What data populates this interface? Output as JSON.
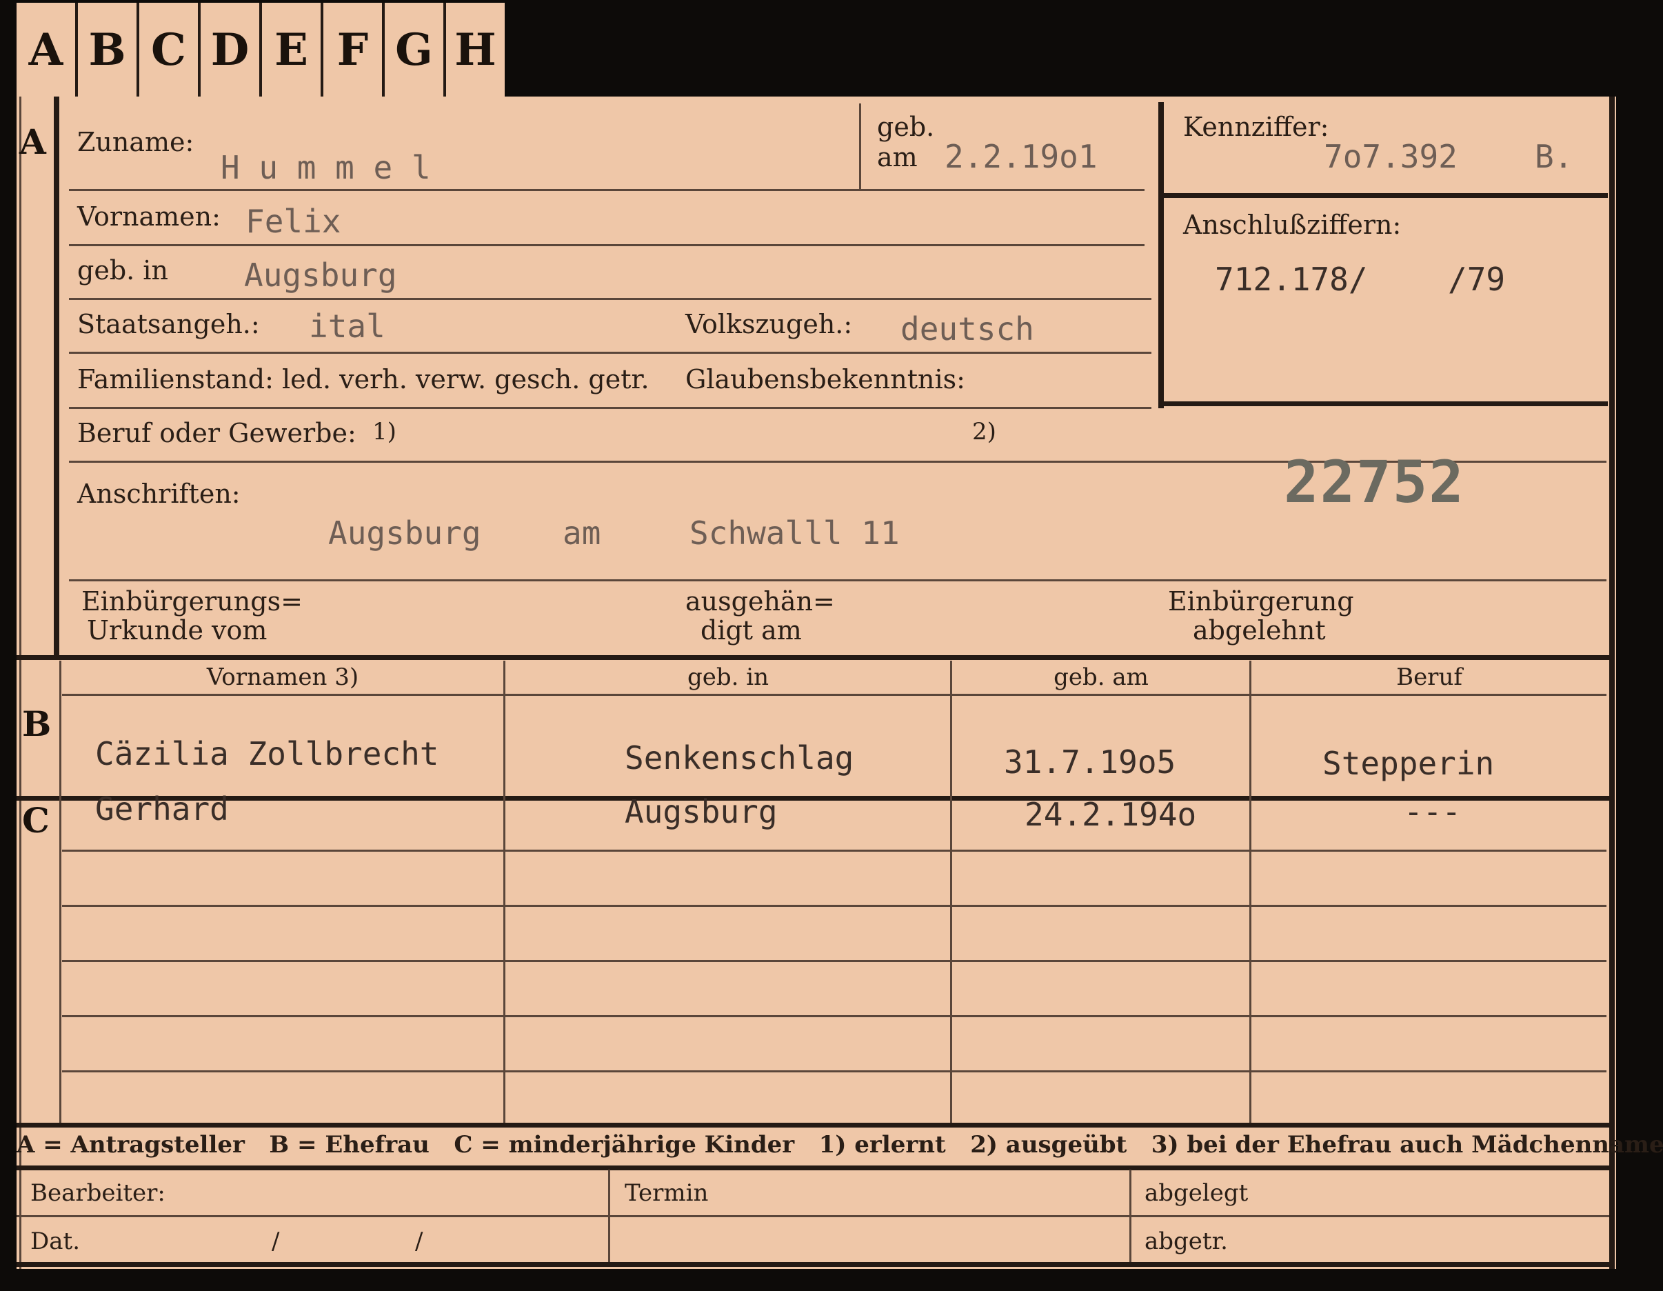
{
  "tabs": [
    "A",
    "B",
    "C",
    "D",
    "E",
    "F",
    "G",
    "H"
  ],
  "sections": {
    "a": "A",
    "b": "B",
    "c": "C"
  },
  "applicant": {
    "surname_label": "Zuname:",
    "surname": "H u m m e l",
    "birth_label_1": "geb.",
    "birth_label_2": "am",
    "birth_date": "2.2.19o1",
    "firstnames_label": "Vornamen:",
    "firstnames": "Felix",
    "birthplace_label": "geb. in",
    "birthplace": "Augsburg",
    "citizenship_label": "Staatsangeh.:",
    "citizenship": "ital",
    "ethnicity_label": "Volkszugeh.:",
    "ethnicity": "deutsch",
    "family_status_label": "Familienstand: led. verh. verw. gesch. getr.",
    "religion_label": "Glaubensbekenntnis:",
    "profession_label": "Beruf oder Gewerbe:",
    "profession_fn1": "1)",
    "profession_fn2": "2)",
    "addresses_label": "Anschriften:",
    "address_city": "Augsburg",
    "address_am": "am",
    "address_street": "Schwalll 11"
  },
  "reference": {
    "id_label": "Kennziffer:",
    "id_value": "7o7.392",
    "id_suffix": "B.",
    "links_label": "Anschlußziffern:",
    "links_value": "712.178/",
    "links_value_2": "/79"
  },
  "stamp_number": "22752",
  "naturalization": {
    "certificate_label_1": "Einbürgerungs=",
    "certificate_label_2": "Urkunde vom",
    "handed_label_1": "ausgehän=",
    "handed_label_2": "digt am",
    "rejected_label_1": "Einbürgerung",
    "rejected_label_2": "abgelehnt"
  },
  "family_columns": [
    "Vornamen 3)",
    "geb. in",
    "geb. am",
    "Beruf"
  ],
  "spouse": {
    "name": "Cäzilia Zollbrecht",
    "birthplace": "Senkenschlag",
    "birth_date": "31.7.19o5",
    "profession": "Stepperin"
  },
  "children": [
    {
      "name": "Gerhard",
      "birthplace": "Augsburg",
      "birth_date": "24.2.194o",
      "profession": "---"
    }
  ],
  "legend": "A = Antragsteller   B = Ehefrau   C = minderjährige Kinder   1) erlernt   2) ausgeübt   3) bei der Ehefrau auch Mädchenname",
  "footer": {
    "clerk_label": "Bearbeiter:",
    "date_label": "Dat.",
    "date_sep_1": "/",
    "date_sep_2": "/",
    "term_label": "Termin",
    "filed_label": "abgelegt",
    "sent_label": "abgetr."
  }
}
